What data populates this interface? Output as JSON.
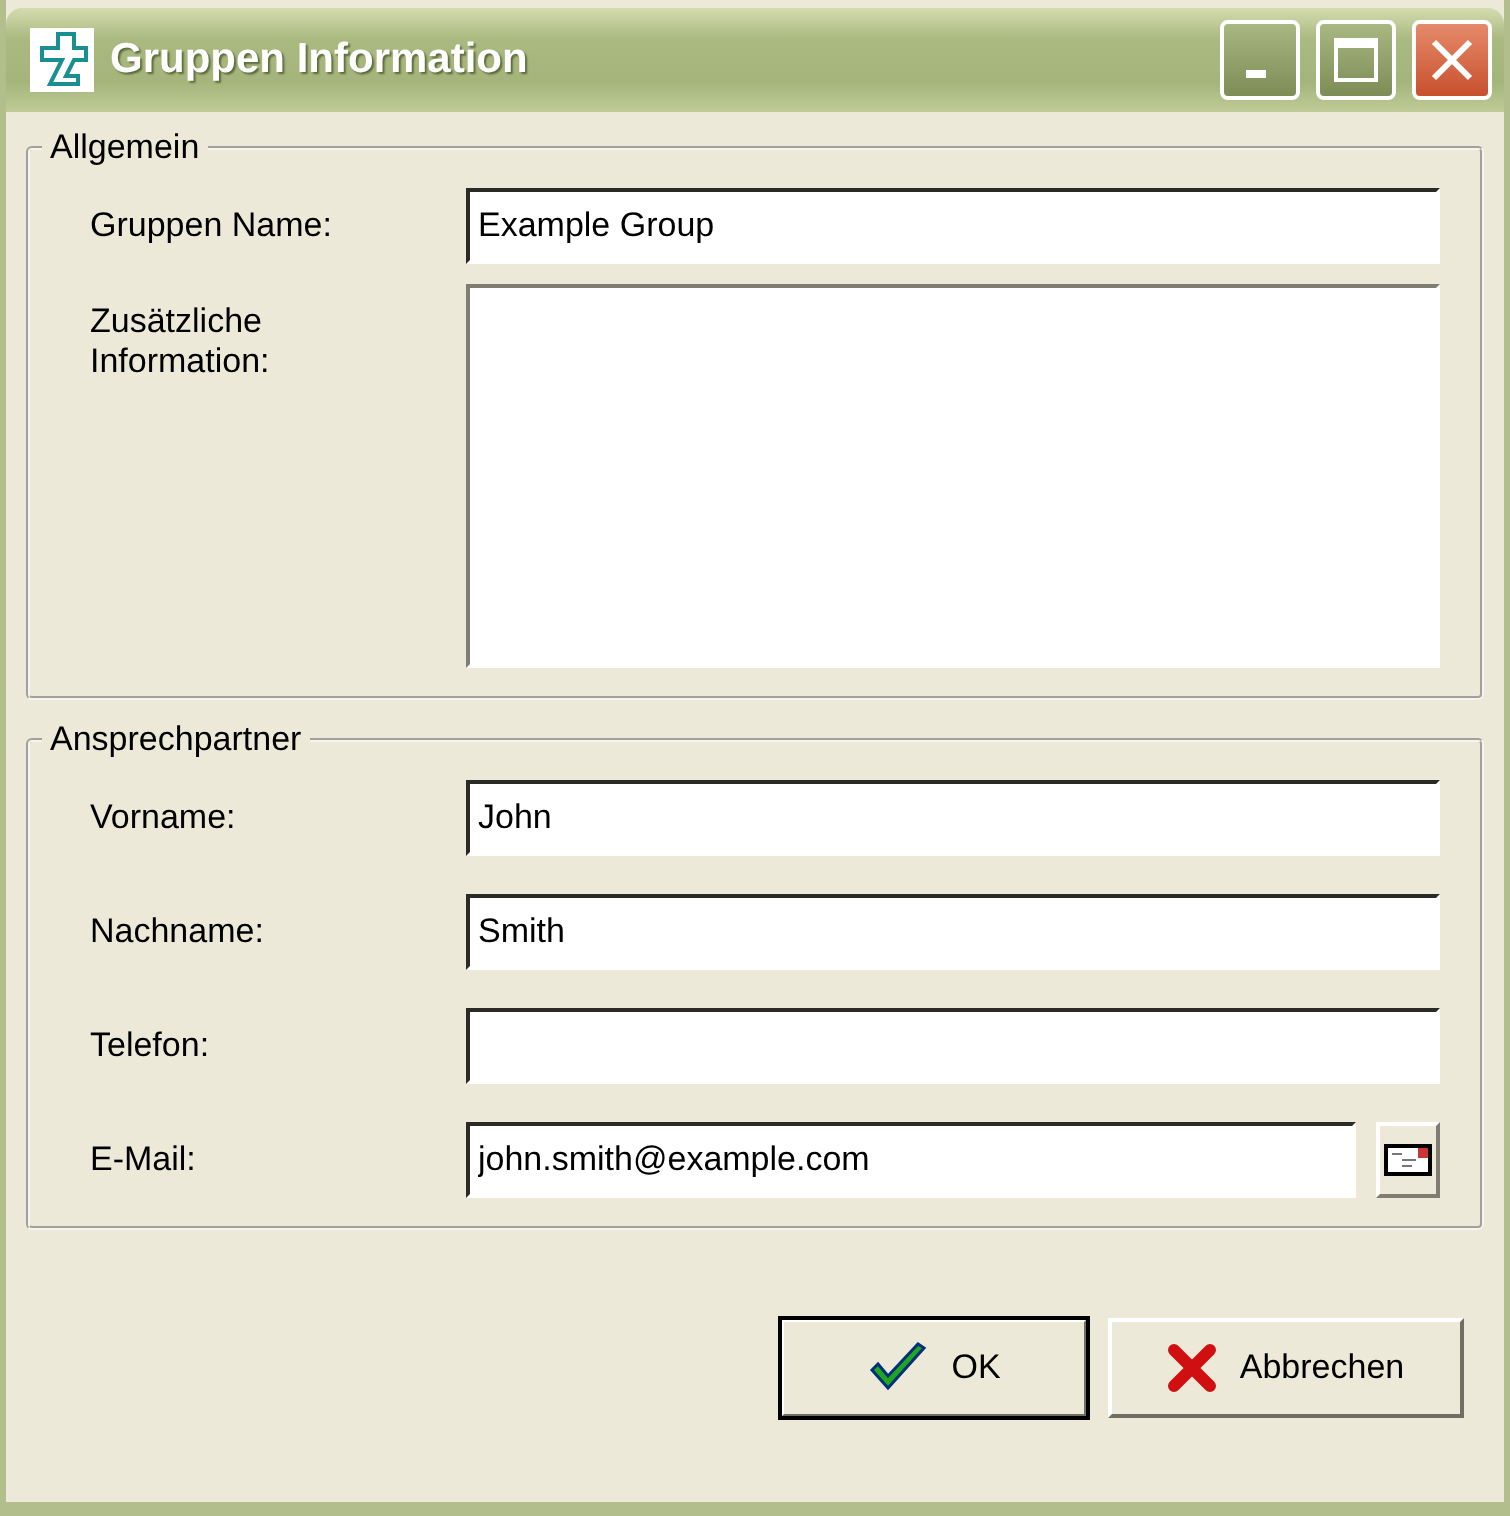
{
  "window": {
    "title": "Gruppen Information"
  },
  "general": {
    "legend": "Allgemein",
    "fields": [
      {
        "kind": "input",
        "label": "Gruppen Name:",
        "value": "Example Group"
      },
      {
        "kind": "textarea",
        "label": "Zusätzliche Information:"
      }
    ]
  },
  "contact": {
    "legend": "Ansprechpartner",
    "fields": [
      {
        "kind": "input",
        "label": "Vorname:",
        "value": "John"
      },
      {
        "kind": "input",
        "label": "Nachname:",
        "value": "Smith"
      },
      {
        "kind": "input",
        "label": "Telefon:"
      },
      {
        "kind": "email",
        "label": "E-Mail:",
        "value": "john.smith@example.com"
      }
    ]
  },
  "buttons": [
    {
      "kind": "ok",
      "label": "OK"
    },
    {
      "kind": "cancel",
      "label": "Abbrechen"
    }
  ]
}
